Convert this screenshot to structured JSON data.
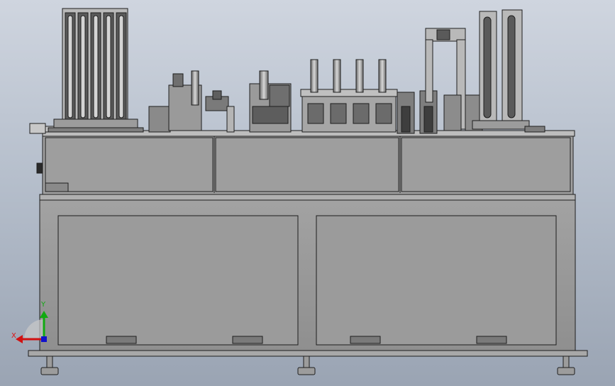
{
  "viewport": {
    "background_top": "#cfd5df",
    "background_bottom": "#9aa4b3"
  },
  "machine": {
    "frame_color": "#8e8e8e",
    "panel_color": "#9a9a9a",
    "outline_color": "#1e1e1e",
    "rail_color": "#b4b4b4"
  },
  "triad": {
    "x_label": "X",
    "y_label": "Y",
    "x_color": "#d11111",
    "y_color": "#11aa11",
    "z_color": "#1111cc"
  }
}
